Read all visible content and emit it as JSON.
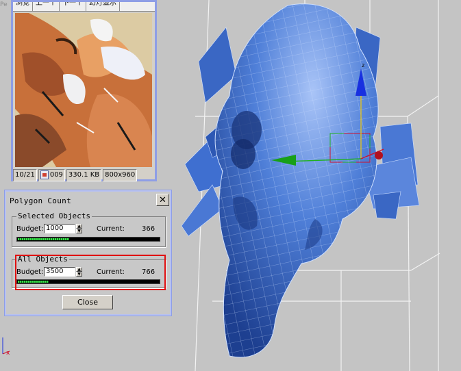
{
  "viewport": {
    "corner_label": "Pe",
    "gizmo_z_label": "z",
    "mini_axis_x_label": "x",
    "colors": {
      "mesh": "#4f7fd8",
      "mesh_dark": "#1d3f90",
      "grid": "#f2f2f2",
      "gizmo_x": "#d0102a",
      "gizmo_y": "#20b020",
      "gizmo_z": "#1830e0"
    }
  },
  "image_viewer": {
    "menu": [
      "浏览",
      "上一个",
      "下一个",
      "幻灯显示"
    ],
    "status": {
      "index": "10/21",
      "file": "009",
      "size": "330.1 KB",
      "dimensions": "800x960"
    }
  },
  "polygon_count": {
    "title": "Polygon Count",
    "selected": {
      "label": "Selected Objects",
      "budget_label": "Budget:",
      "budget": "1000",
      "current_label": "Current:",
      "current": "366",
      "progress": 0.366
    },
    "all": {
      "label": "All Objects",
      "budget_label": "Budget:",
      "budget": "3500",
      "current_label": "Current:",
      "current": "766",
      "progress": 0.219
    },
    "close_label": "Close"
  }
}
